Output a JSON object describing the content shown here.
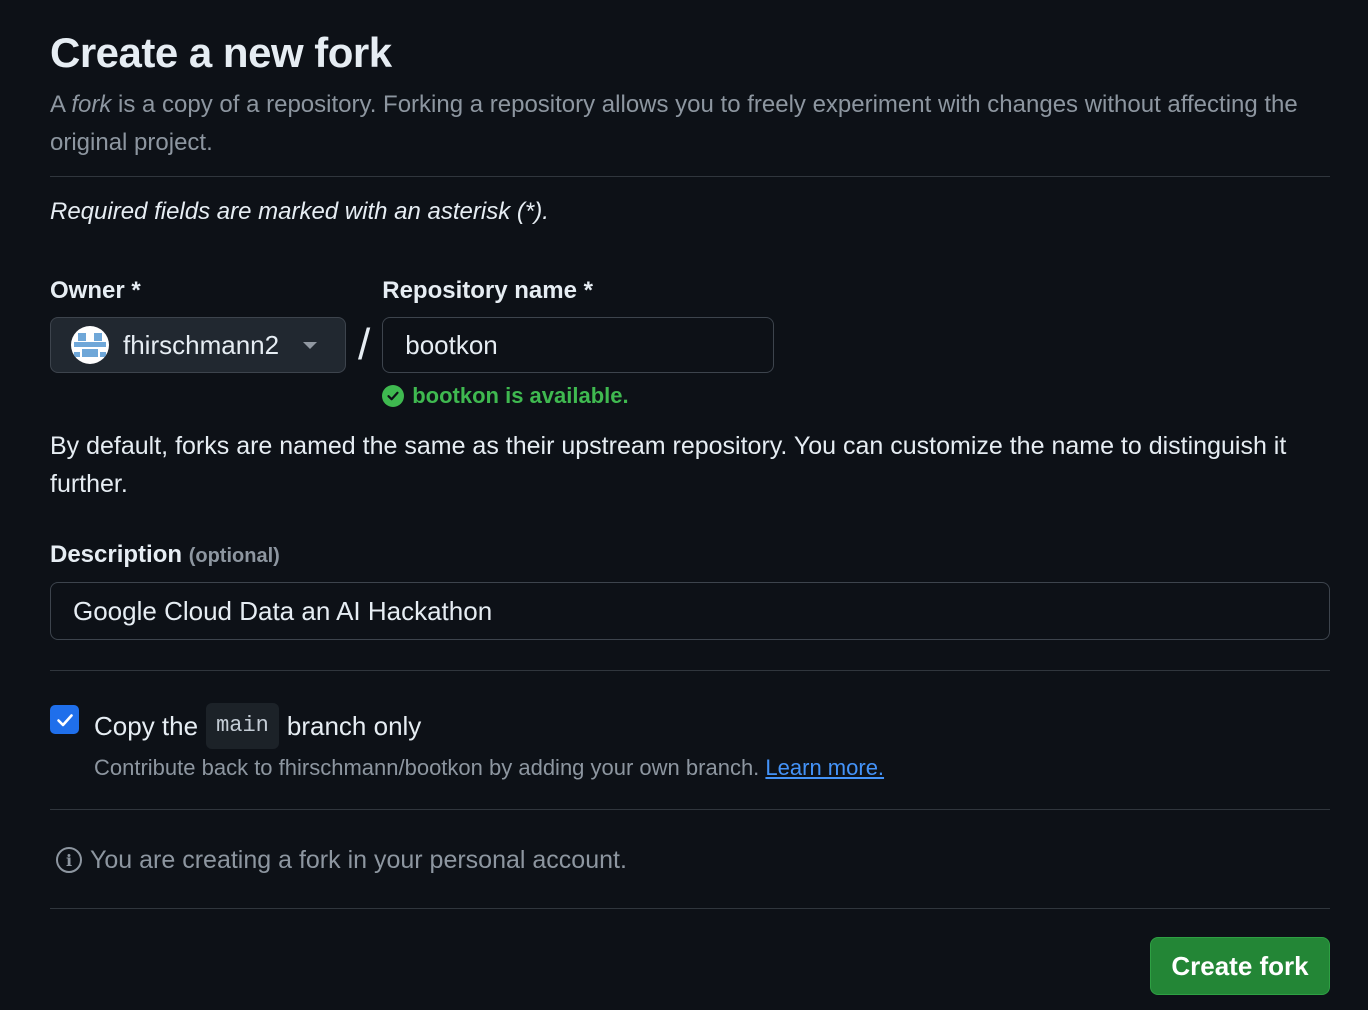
{
  "header": {
    "title": "Create a new fork",
    "subtitle_prefix": "A ",
    "subtitle_em": "fork",
    "subtitle_rest": " is a copy of a repository. Forking a repository allows you to freely experiment with changes without affecting the original project."
  },
  "required_note": "Required fields are marked with an asterisk (*).",
  "owner": {
    "label": "Owner *",
    "value": "fhirschmann2"
  },
  "repo": {
    "label": "Repository name *",
    "value": "bootkon",
    "availability": "bootkon is available."
  },
  "help_text": "By default, forks are named the same as their upstream repository. You can customize the name to distinguish it further.",
  "description": {
    "label": "Description",
    "optional": "(optional)",
    "value": "Google Cloud Data an AI Hackathon"
  },
  "copy_branch": {
    "checked": true,
    "label_before": "Copy the",
    "branch": "main",
    "label_after": "branch only",
    "sub_text": "Contribute back to fhirschmann/bootkon by adding your own branch.",
    "learn_more": "Learn more."
  },
  "info": {
    "text": "You are creating a fork in your personal account."
  },
  "footer": {
    "create_label": "Create fork"
  },
  "colors": {
    "background": "#0d1117",
    "success": "#3fb950",
    "primary_button": "#238636",
    "checkbox": "#1f6feb",
    "link": "#4493f8"
  }
}
